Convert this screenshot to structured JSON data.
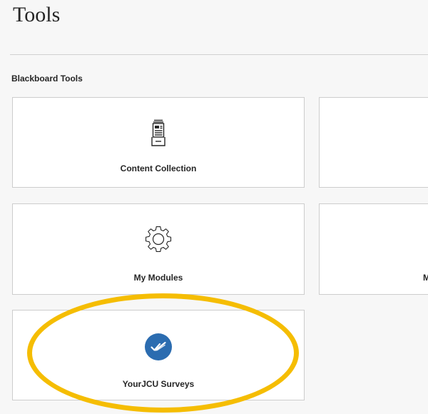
{
  "page": {
    "title": "Tools"
  },
  "section": {
    "heading": "Blackboard Tools"
  },
  "tiles": [
    {
      "label": "Content Collection",
      "icon": "content-collection-icon"
    },
    {
      "label": "",
      "icon": ""
    },
    {
      "label": "My Modules",
      "icon": "gear-icon"
    },
    {
      "label": "M",
      "icon": ""
    },
    {
      "label": "YourJCU Surveys",
      "icon": "survey-check-icon"
    }
  ],
  "colors": {
    "highlight": "#f5bd02",
    "survey_icon_bg": "#2b6cb0",
    "tile_border": "#cdcdcd",
    "background": "#f7f7f7"
  }
}
